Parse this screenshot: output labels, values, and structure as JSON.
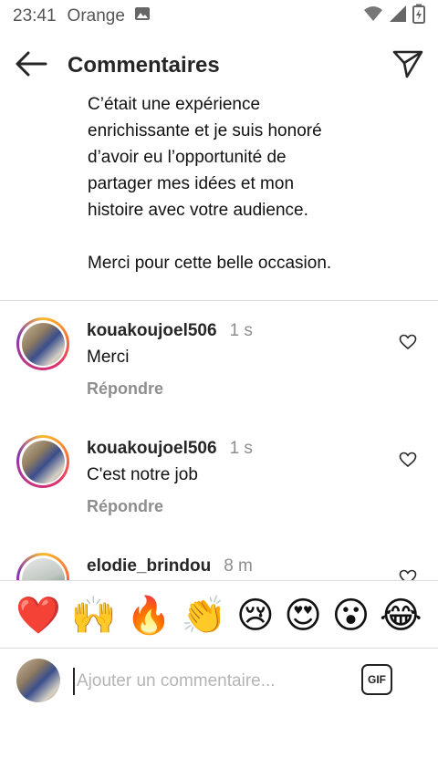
{
  "status_bar": {
    "time": "23:41",
    "carrier": "Orange"
  },
  "header": {
    "title": "Commentaires"
  },
  "caption": {
    "lines": [
      "C’était une expérience",
      "enrichissante et je suis honoré",
      "d’avoir eu l’opportunité de",
      "partager mes idées et mon",
      "histoire avec votre audience."
    ],
    "closing": "Merci pour cette belle occasion."
  },
  "comments": [
    {
      "username": "kouakoujoel506",
      "time": "1 s",
      "text": "Merci",
      "reply_label": "Répondre"
    },
    {
      "username": "kouakoujoel506",
      "time": "1 s",
      "text": "C'est notre job",
      "reply_label": "Répondre"
    },
    {
      "username": "elodie_brindou",
      "time": "8 m",
      "text": "",
      "reply_label": ""
    }
  ],
  "emoji_bar": [
    "❤️",
    "🙌",
    "🔥",
    "👏",
    "😢",
    "😍",
    "😮",
    "😂"
  ],
  "input": {
    "placeholder": "Ajouter un commentaire...",
    "value": "",
    "gif_label": "GIF"
  },
  "colors": {
    "text_primary": "#262626",
    "text_secondary": "#8e8e8e",
    "divider": "#dbdbdb",
    "placeholder": "#b5b5b5"
  }
}
